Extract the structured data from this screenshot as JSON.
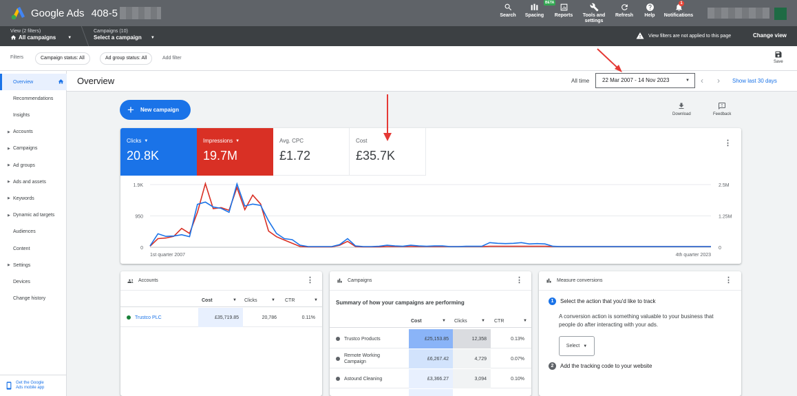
{
  "topbar": {
    "app_name": "Google Ads",
    "account_id": "408-5",
    "tools": [
      {
        "label": "Search",
        "icon": "search-icon"
      },
      {
        "label": "Spacing",
        "icon": "spacing-icon",
        "badge": "BETA"
      },
      {
        "label": "Reports",
        "icon": "reports-icon"
      },
      {
        "label": "Tools and settings",
        "icon": "wrench-icon"
      },
      {
        "label": "Refresh",
        "icon": "refresh-icon"
      },
      {
        "label": "Help",
        "icon": "help-icon"
      },
      {
        "label": "Notifications",
        "icon": "bell-icon",
        "badge": "1"
      }
    ]
  },
  "viewbar": {
    "view_small": "View (2 filters)",
    "view_big": "All campaigns",
    "campaigns_small": "Campaigns (10)",
    "campaigns_big": "Select a campaign",
    "warning": "View filters are not applied to this page",
    "change_view": "Change view"
  },
  "filters": {
    "label": "Filters",
    "chips": [
      "Campaign status: All",
      "Ad group status: All"
    ],
    "add_filter": "Add filter",
    "save": "Save"
  },
  "sidebar": {
    "items": [
      {
        "label": "Overview",
        "active": true,
        "expandable": false
      },
      {
        "label": "Recommendations",
        "expandable": false
      },
      {
        "label": "Insights",
        "expandable": false
      },
      {
        "label": "Accounts",
        "expandable": true
      },
      {
        "label": "Campaigns",
        "expandable": true
      },
      {
        "label": "Ad groups",
        "expandable": true
      },
      {
        "label": "Ads and assets",
        "expandable": true
      },
      {
        "label": "Keywords",
        "expandable": true
      },
      {
        "label": "Dynamic ad targets",
        "expandable": true
      },
      {
        "label": "Audiences",
        "expandable": false
      },
      {
        "label": "Content",
        "expandable": false
      },
      {
        "label": "Settings",
        "expandable": true
      },
      {
        "label": "Devices",
        "expandable": false
      },
      {
        "label": "Change history",
        "expandable": false
      }
    ],
    "mobile_line1": "Get the Google",
    "mobile_line2": "Ads mobile app"
  },
  "page": {
    "title": "Overview",
    "all_time": "All time",
    "date_range": "22 Mar 2007 - 14 Nov 2023",
    "show_last": "Show last 30 days",
    "new_campaign": "New campaign",
    "download": "Download",
    "feedback": "Feedback"
  },
  "metrics": [
    {
      "label": "Clicks",
      "value": "20.8K",
      "dropdown": true,
      "color": "#1a73e8"
    },
    {
      "label": "Impressions",
      "value": "19.7M",
      "dropdown": true,
      "color": "#d93025"
    },
    {
      "label": "Avg. CPC",
      "value": "£1.72"
    },
    {
      "label": "Cost",
      "value": "£35.7K"
    }
  ],
  "chart_data": {
    "type": "line",
    "x_labels": [
      "1st quarter 2007",
      "4th quarter 2023"
    ],
    "left_axis_ticks": [
      "1.9K",
      "950",
      "0"
    ],
    "right_axis_ticks": [
      "2.5M",
      "1.25M",
      "0"
    ],
    "left_ylim": [
      0,
      1900
    ],
    "right_ylim": [
      0,
      2500000
    ],
    "series": [
      {
        "name": "Clicks",
        "color": "#1a73e8",
        "axis": "left",
        "values": [
          40,
          410,
          330,
          340,
          380,
          320,
          1300,
          1370,
          1220,
          1180,
          1060,
          1920,
          1250,
          1310,
          1270,
          800,
          420,
          260,
          230,
          60,
          20,
          20,
          20,
          20,
          80,
          260,
          40,
          20,
          20,
          30,
          60,
          40,
          30,
          60,
          40,
          30,
          40,
          40,
          20,
          20,
          30,
          30,
          30,
          140,
          120,
          110,
          120,
          140,
          100,
          110,
          100,
          30,
          20,
          20,
          20,
          20,
          20,
          20,
          20,
          20,
          20,
          20,
          20,
          20,
          20,
          20,
          20,
          20,
          20,
          20,
          20,
          20
        ]
      },
      {
        "name": "Impressions",
        "color": "#d93025",
        "axis": "left_scaled",
        "values": [
          30,
          260,
          280,
          330,
          570,
          420,
          1060,
          1930,
          1170,
          1200,
          1120,
          1810,
          1140,
          1580,
          1310,
          490,
          320,
          220,
          120,
          20,
          10,
          10,
          10,
          10,
          60,
          180,
          20,
          10,
          10,
          10,
          20,
          20,
          20,
          20,
          20,
          20,
          20,
          20,
          20,
          20,
          20,
          20,
          20,
          30,
          30,
          30,
          30,
          30,
          30,
          30,
          30,
          20,
          20,
          20,
          20,
          20,
          20,
          20,
          20,
          20,
          20,
          20,
          20,
          20,
          20,
          20,
          20,
          20,
          20,
          20,
          20,
          20
        ]
      }
    ]
  },
  "accounts_card": {
    "title": "Accounts",
    "headers": [
      "Cost",
      "Clicks",
      "CTR"
    ],
    "rows": [
      {
        "name": "Trustco PLC",
        "cost": "£35,719.85",
        "clicks": "20,786",
        "ctr": "0.11%",
        "dot": "#188038"
      }
    ]
  },
  "campaigns_card": {
    "title": "Campaigns",
    "summary": "Summary of how your campaigns are performing",
    "headers": [
      "Cost",
      "Clicks",
      "CTR"
    ],
    "rows": [
      {
        "name": "Trustco Products",
        "cost": "£25,153.85",
        "clicks": "12,358",
        "ctr": "0.13%"
      },
      {
        "name": "Remote Working Campaign",
        "name_line1": "Remote Working",
        "name_line2": "Campaign",
        "cost": "£6,267.42",
        "clicks": "4,729",
        "ctr": "0.07%"
      },
      {
        "name": "Astound Cleaning",
        "cost": "£3,366.27",
        "clicks": "3,094",
        "ctr": "0.10%"
      }
    ]
  },
  "conversions_card": {
    "title": "Measure conversions",
    "step1": "Select the action that you'd like to track",
    "step1_desc": "A conversion action is something valuable to your business that people do after interacting with your ads.",
    "select_label": "Select",
    "step2": "Add the tracking code to your website"
  }
}
